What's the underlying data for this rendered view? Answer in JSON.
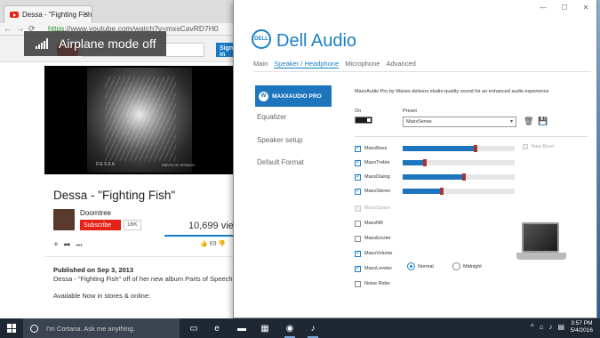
{
  "airplane_toast": {
    "text": "Airplane mode off",
    "icon": "signal-bars-icon"
  },
  "browser": {
    "tab_title": "Dessa - \"Fighting Fish\"",
    "tab_close": "×",
    "nav": {
      "back": "←",
      "forward": "→",
      "reload": "⟳"
    },
    "url_secure": "https",
    "url_rest": "://www.youtube.com/watch?v=mxsCavRD7H0",
    "search_placeholder": "Search",
    "signin_label": "Sign in",
    "video": {
      "caption_left": "DESSA",
      "caption_right": "PARTS OF SPEECH",
      "title": "Dessa - \"Fighting Fish\"",
      "channel": "Doomtree",
      "subscribe_label": "Subscribe",
      "subscriber_count": "16K",
      "views": "10,699 views",
      "likes": "69",
      "actions_add": "+",
      "actions_share": "➦",
      "actions_more": "•••",
      "like_icon": "thumbs-up-icon",
      "dislike_icon": "thumbs-down-icon"
    },
    "description": {
      "published": "Published on Sep 3, 2013",
      "line1": "Dessa - \"Fighting Fish\" off of her new album Parts of Speech.",
      "line2": "Available Now in stores & online:"
    }
  },
  "dell_audio": {
    "title": "Dell Audio",
    "logo_text": "DELL",
    "window_controls": {
      "minimize": "—",
      "maximize": "☐",
      "close": "✕"
    },
    "tabs": [
      {
        "label": "Main",
        "active": false
      },
      {
        "label": "Speaker / Headphone",
        "active": true
      },
      {
        "label": "Microphone",
        "active": false
      },
      {
        "label": "Advanced",
        "active": false
      }
    ],
    "brand_label": "MAXXAUDIO PRO",
    "brand_mark": "W",
    "sidebar": [
      {
        "label": "Equalizer"
      },
      {
        "label": "Speaker setup"
      },
      {
        "label": "Default Format"
      }
    ],
    "description": "MaxxAudio Pro by Waves delivers studio-quality sound for an enhanced audio experience",
    "on_label": "On",
    "on_state": true,
    "preset_label": "Preset",
    "preset_value": "MaxxSense",
    "trash_icon": "trash-icon",
    "save_icon": "save-icon",
    "bass_boost_label": "Bass Boost",
    "features": [
      {
        "label": "MaxxBass",
        "checked": true,
        "enabled": true,
        "slider": 0.65
      },
      {
        "label": "MaxxTreble",
        "checked": true,
        "enabled": true,
        "slider": 0.2
      },
      {
        "label": "MaxxDialog",
        "checked": true,
        "enabled": true,
        "slider": 0.55
      },
      {
        "label": "MaxxStereo",
        "checked": true,
        "enabled": true,
        "slider": 0.35
      },
      {
        "label": "MaxxSpace",
        "checked": false,
        "enabled": false
      },
      {
        "label": "MaxxNR",
        "checked": false,
        "enabled": true
      },
      {
        "label": "MaxxExciter",
        "checked": false,
        "enabled": true
      },
      {
        "label": "MaxxVolume",
        "checked": true,
        "enabled": true
      },
      {
        "label": "MaxxLeveler",
        "checked": true,
        "enabled": true
      },
      {
        "label": "Noise Rider",
        "checked": false,
        "enabled": true
      }
    ],
    "leveler_modes": [
      {
        "label": "Normal",
        "selected": true
      },
      {
        "label": "Midnight",
        "selected": false
      }
    ],
    "device_icon": "laptop-icon"
  },
  "taskbar": {
    "cortana_placeholder": "I'm Cortana. Ask me anything.",
    "apps": [
      {
        "name": "task-view-icon",
        "glyph": "▭"
      },
      {
        "name": "edge-icon",
        "glyph": "e"
      },
      {
        "name": "file-explorer-icon",
        "glyph": "▬"
      },
      {
        "name": "store-icon",
        "glyph": "▦"
      },
      {
        "name": "chrome-icon",
        "glyph": "◉"
      },
      {
        "name": "dell-audio-icon",
        "glyph": "♪"
      }
    ],
    "tray": {
      "chevron": "^",
      "network": "⌂",
      "volume": "♪",
      "message": "▤"
    },
    "time": "3:57 PM",
    "date": "5/4/2016"
  },
  "colors": {
    "accent": "#1a7fc4",
    "youtube_red": "#e62117",
    "taskbar": "#1f2733"
  }
}
